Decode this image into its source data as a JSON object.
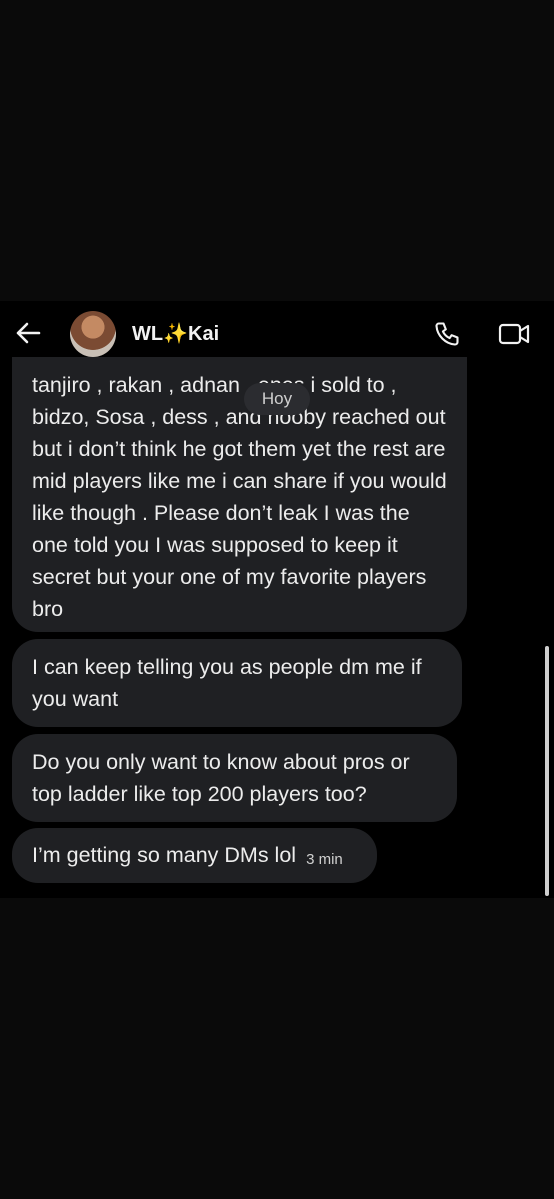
{
  "header": {
    "contact_name": "WL✨Kai"
  },
  "icons": {
    "back": "arrow-left-icon",
    "call": "phone-icon",
    "video": "video-camera-icon"
  },
  "date_pill": "Hoy",
  "messages": [
    {
      "text": "tanjiro , rakan , adnan , enes i sold to , bidzo, Sosa , dess , and nooby reached out but i don’t think he got them yet the rest are mid players like me i can share if you would like though . Please don’t leak I was the one told you I was supposed to keep it secret but your one of my favorite players bro"
    },
    {
      "text": "I can keep telling you as people dm me if you want"
    },
    {
      "text": "Do you only want to know about pros or top ladder like top 200 players too?"
    },
    {
      "text": "I’m getting so many DMs lol",
      "time": "3 min"
    }
  ],
  "colors": {
    "bubble": "#1f2023",
    "background": "#000000",
    "text": "#ececec"
  }
}
